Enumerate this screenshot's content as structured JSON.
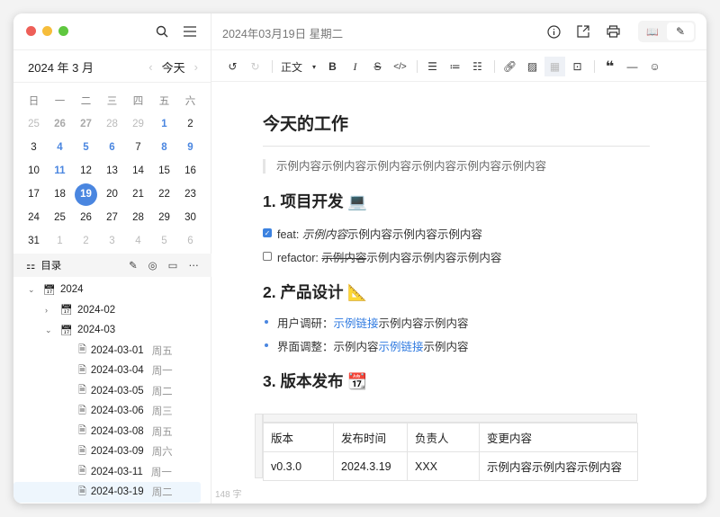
{
  "sidebar": {
    "month_label": "2024 年 3 月",
    "today_label": "今天",
    "weekdays": [
      "日",
      "一",
      "二",
      "三",
      "四",
      "五",
      "六"
    ],
    "days": [
      {
        "d": "25",
        "t": "o"
      },
      {
        "d": "26",
        "t": "ob"
      },
      {
        "d": "27",
        "t": "ob"
      },
      {
        "d": "28",
        "t": "o"
      },
      {
        "d": "29",
        "t": "o"
      },
      {
        "d": "1",
        "t": "b"
      },
      {
        "d": "2",
        "t": ""
      },
      {
        "d": "3",
        "t": ""
      },
      {
        "d": "4",
        "t": "b"
      },
      {
        "d": "5",
        "t": "b"
      },
      {
        "d": "6",
        "t": "b"
      },
      {
        "d": "7",
        "t": ""
      },
      {
        "d": "8",
        "t": "b"
      },
      {
        "d": "9",
        "t": "b"
      },
      {
        "d": "10",
        "t": ""
      },
      {
        "d": "11",
        "t": "b"
      },
      {
        "d": "12",
        "t": ""
      },
      {
        "d": "13",
        "t": ""
      },
      {
        "d": "14",
        "t": ""
      },
      {
        "d": "15",
        "t": ""
      },
      {
        "d": "16",
        "t": ""
      },
      {
        "d": "17",
        "t": ""
      },
      {
        "d": "18",
        "t": ""
      },
      {
        "d": "19",
        "t": "sel"
      },
      {
        "d": "20",
        "t": ""
      },
      {
        "d": "21",
        "t": ""
      },
      {
        "d": "22",
        "t": ""
      },
      {
        "d": "23",
        "t": ""
      },
      {
        "d": "24",
        "t": ""
      },
      {
        "d": "25",
        "t": ""
      },
      {
        "d": "26",
        "t": ""
      },
      {
        "d": "27",
        "t": ""
      },
      {
        "d": "28",
        "t": ""
      },
      {
        "d": "29",
        "t": ""
      },
      {
        "d": "30",
        "t": ""
      },
      {
        "d": "31",
        "t": ""
      },
      {
        "d": "1",
        "t": "o"
      },
      {
        "d": "2",
        "t": "o"
      },
      {
        "d": "3",
        "t": "o"
      },
      {
        "d": "4",
        "t": "o"
      },
      {
        "d": "5",
        "t": "o"
      },
      {
        "d": "6",
        "t": "o"
      }
    ],
    "outline_label": "目录",
    "tree": [
      {
        "label": "2024",
        "level": 0,
        "type": "folder",
        "chevron": "down"
      },
      {
        "label": "2024-02",
        "level": 1,
        "type": "folder",
        "chevron": "right"
      },
      {
        "label": "2024-03",
        "level": 1,
        "type": "folder",
        "chevron": "down"
      },
      {
        "label": "2024-03-01",
        "weekday": "周五",
        "level": 2,
        "type": "file"
      },
      {
        "label": "2024-03-04",
        "weekday": "周一",
        "level": 2,
        "type": "file"
      },
      {
        "label": "2024-03-05",
        "weekday": "周二",
        "level": 2,
        "type": "file"
      },
      {
        "label": "2024-03-06",
        "weekday": "周三",
        "level": 2,
        "type": "file"
      },
      {
        "label": "2024-03-08",
        "weekday": "周五",
        "level": 2,
        "type": "file"
      },
      {
        "label": "2024-03-09",
        "weekday": "周六",
        "level": 2,
        "type": "file"
      },
      {
        "label": "2024-03-11",
        "weekday": "周一",
        "level": 2,
        "type": "file"
      },
      {
        "label": "2024-03-19",
        "weekday": "周二",
        "level": 2,
        "type": "file",
        "current": true
      }
    ]
  },
  "header": {
    "date": "2024年03月19日 星期二"
  },
  "toolbar": {
    "paragraph_style": "正文"
  },
  "doc": {
    "title": "今天的工作",
    "quote": "示例内容示例内容示例内容示例内容示例内容示例内容",
    "h1": "1. 项目开发 💻",
    "task1": {
      "prefix": "feat: ",
      "italic": "示例内容",
      "rest": "示例内容示例内容示例内容",
      "checked": true
    },
    "task2": {
      "prefix": "refactor: ",
      "strike": "示例内容",
      "rest": "示例内容示例内容示例内容",
      "checked": false
    },
    "h2": "2. 产品设计 📐",
    "b1": {
      "label": "用户调研：",
      "link": "示例链接",
      "rest": "示例内容示例内容"
    },
    "b2": {
      "label": "界面调整：",
      "pre": "示例内容",
      "link": "示例链接",
      "rest": "示例内容"
    },
    "h3": "3. 版本发布 📆",
    "table": {
      "headers": [
        "版本",
        "发布时间",
        "负责人",
        "变更内容"
      ],
      "rows": [
        [
          "v0.3.0",
          "2024.3.19",
          "XXX",
          "示例内容示例内容示例内容"
        ]
      ]
    }
  },
  "word_count": "148 字",
  "colors": {
    "accent": "#4a86e0",
    "link": "#2f7ae0"
  }
}
